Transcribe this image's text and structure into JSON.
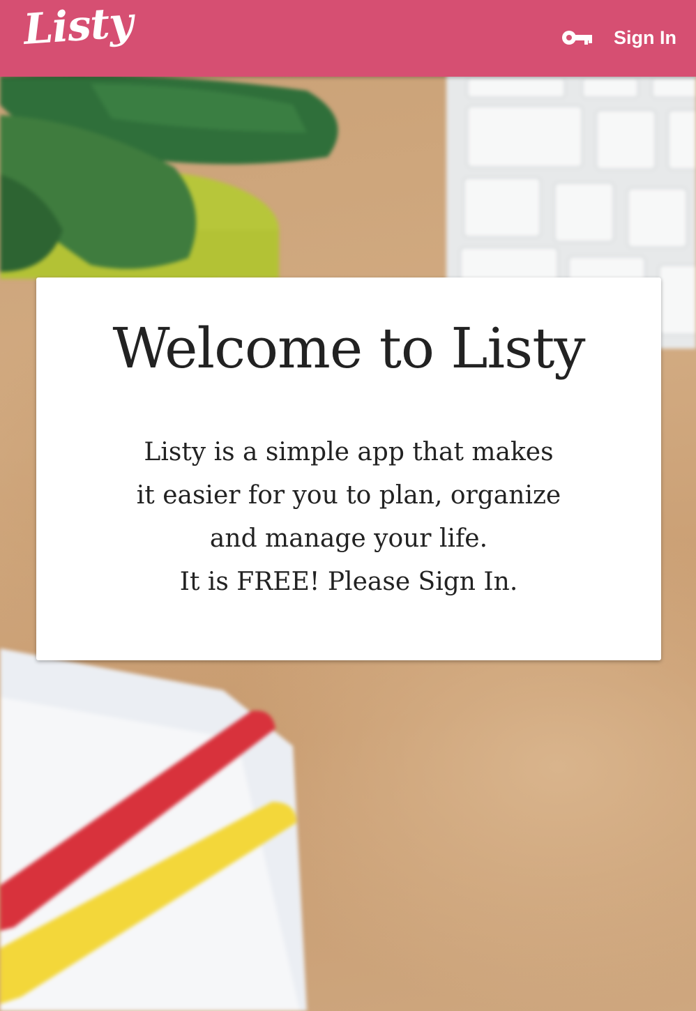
{
  "header": {
    "logo": "Listy",
    "signin_label": "Sign In",
    "signin_icon": "key-icon",
    "background_color": "#d64f72"
  },
  "card": {
    "title": "Welcome to Listy",
    "lines": [
      "Listy is a simple app that makes",
      "it easier for you to plan, organize",
      "and manage your life.",
      "It is FREE! Please Sign In."
    ]
  }
}
